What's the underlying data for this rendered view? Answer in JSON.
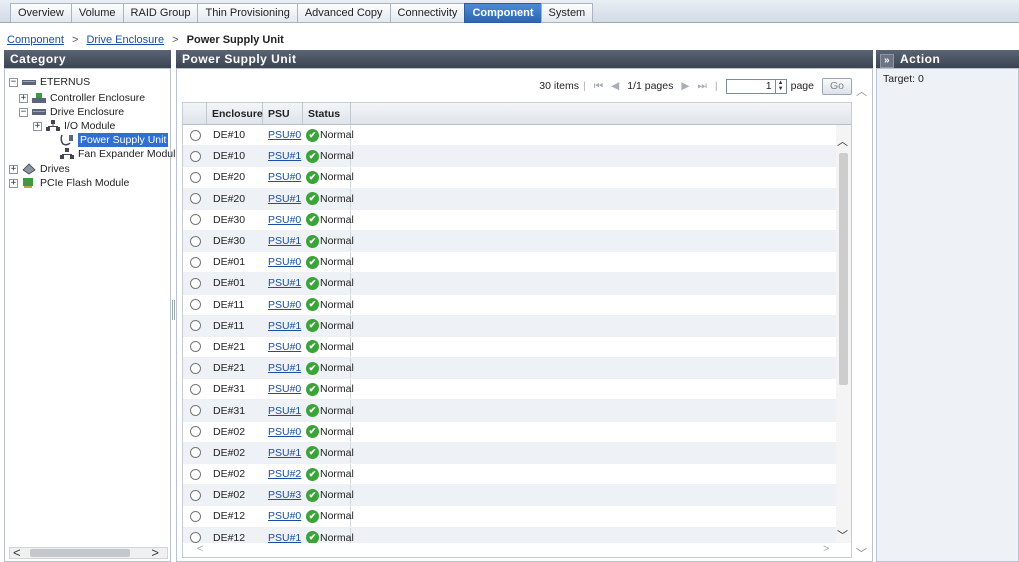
{
  "tabs": [
    {
      "label": "Overview",
      "active": false
    },
    {
      "label": "Volume",
      "active": false
    },
    {
      "label": "RAID Group",
      "active": false
    },
    {
      "label": "Thin Provisioning",
      "active": false
    },
    {
      "label": "Advanced Copy",
      "active": false
    },
    {
      "label": "Connectivity",
      "active": false
    },
    {
      "label": "Component",
      "active": true
    },
    {
      "label": "System",
      "active": false
    }
  ],
  "breadcrumb": {
    "items": [
      "Component",
      "Drive Enclosure"
    ],
    "current": "Power Supply Unit",
    "separator": ">"
  },
  "category": {
    "title": "Category",
    "tree": {
      "root": "ETERNUS",
      "controller_enclosure": "Controller Enclosure",
      "drive_enclosure": "Drive Enclosure",
      "io_module": "I/O Module",
      "power_supply_unit": "Power Supply Unit",
      "fan_expander": "Fan Expander Modul",
      "drives": "Drives",
      "pcie_flash": "PCIe Flash Module"
    },
    "expand_plus": "+",
    "expand_minus": "−",
    "scroll_left": "<",
    "scroll_right": ">"
  },
  "main": {
    "title": "Power Supply Unit",
    "pager": {
      "items": "30 items",
      "pages": "1/1 pages",
      "page_value": "1",
      "page_label": "page",
      "go_label": "Go"
    },
    "columns": [
      "Enclosure",
      "PSU",
      "Status"
    ],
    "rows": [
      {
        "enclosure": "DE#10",
        "psu": "PSU#0",
        "status": "Normal"
      },
      {
        "enclosure": "DE#10",
        "psu": "PSU#1",
        "status": "Normal"
      },
      {
        "enclosure": "DE#20",
        "psu": "PSU#0",
        "status": "Normal"
      },
      {
        "enclosure": "DE#20",
        "psu": "PSU#1",
        "status": "Normal"
      },
      {
        "enclosure": "DE#30",
        "psu": "PSU#0",
        "status": "Normal"
      },
      {
        "enclosure": "DE#30",
        "psu": "PSU#1",
        "status": "Normal"
      },
      {
        "enclosure": "DE#01",
        "psu": "PSU#0",
        "status": "Normal"
      },
      {
        "enclosure": "DE#01",
        "psu": "PSU#1",
        "status": "Normal"
      },
      {
        "enclosure": "DE#11",
        "psu": "PSU#0",
        "status": "Normal"
      },
      {
        "enclosure": "DE#11",
        "psu": "PSU#1",
        "status": "Normal"
      },
      {
        "enclosure": "DE#21",
        "psu": "PSU#0",
        "status": "Normal"
      },
      {
        "enclosure": "DE#21",
        "psu": "PSU#1",
        "status": "Normal"
      },
      {
        "enclosure": "DE#31",
        "psu": "PSU#0",
        "status": "Normal"
      },
      {
        "enclosure": "DE#31",
        "psu": "PSU#1",
        "status": "Normal"
      },
      {
        "enclosure": "DE#02",
        "psu": "PSU#0",
        "status": "Normal"
      },
      {
        "enclosure": "DE#02",
        "psu": "PSU#1",
        "status": "Normal"
      },
      {
        "enclosure": "DE#02",
        "psu": "PSU#2",
        "status": "Normal"
      },
      {
        "enclosure": "DE#02",
        "psu": "PSU#3",
        "status": "Normal"
      },
      {
        "enclosure": "DE#12",
        "psu": "PSU#0",
        "status": "Normal"
      },
      {
        "enclosure": "DE#12",
        "psu": "PSU#1",
        "status": "Normal"
      }
    ]
  },
  "action": {
    "title": "Action",
    "collapse_glyph": "»",
    "target": "Target: 0"
  },
  "icons": {
    "ok": "check-circle-icon",
    "status_ok_color": "#3aa438",
    "accent": "#2f6fcf"
  }
}
